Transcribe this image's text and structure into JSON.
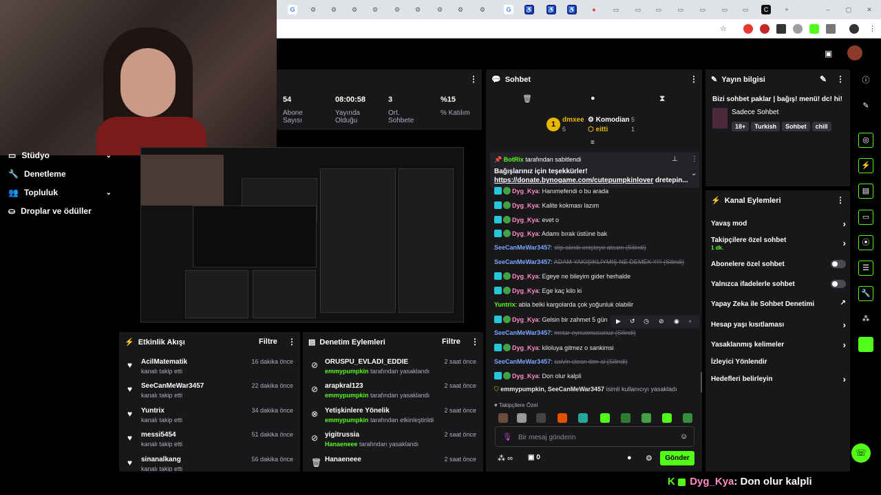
{
  "nav": {
    "items": [
      {
        "label": "Stüdyo",
        "icon": "studio-icon"
      },
      {
        "label": "Denetleme",
        "icon": "wrench-icon"
      },
      {
        "label": "Topluluk",
        "icon": "community-icon"
      },
      {
        "label": "Droplar ve ödüller",
        "icon": "gift-icon"
      }
    ]
  },
  "stats": [
    {
      "value": "54",
      "label1": "Abone",
      "label2": "Sayısı"
    },
    {
      "value": "08:00:58",
      "label1": "Yayında",
      "label2": "Olduğu"
    },
    {
      "value": "3",
      "label1": "Ort.",
      "label2": "Sohbete"
    },
    {
      "value": "%15",
      "label1": "% Katılım",
      "label2": ""
    }
  ],
  "activity": {
    "title": "Etkinlik Akışı",
    "filter": "Filtre",
    "items": [
      {
        "name": "AcilMatematik",
        "sub": "kanalı takip etti",
        "time": "16 dakika önce"
      },
      {
        "name": "SeeCanMeWar3457",
        "sub": "kanalı takip etti",
        "time": "22 dakika önce"
      },
      {
        "name": "Yuntrix",
        "sub": "kanalı takip etti",
        "time": "34 dakika önce"
      },
      {
        "name": "messi5454",
        "sub": "kanalı takip etti",
        "time": "51 dakika önce"
      },
      {
        "name": "sinanalkang",
        "sub": "kanalı takip etti",
        "time": "56 dakika önce"
      }
    ]
  },
  "moderation": {
    "title": "Denetim Eylemleri",
    "filter": "Filtre",
    "items": [
      {
        "name": "ORUSPU_EVLADI_EDDIE",
        "by": "emmypumpkin",
        "sub": "tarafından yasaklandı",
        "time": "2 saat önce"
      },
      {
        "name": "arapkral123",
        "by": "emmypumpkin",
        "sub": "tarafından yasaklandı",
        "time": "2 saat önce"
      },
      {
        "name": "Yetişkinlere Yönelik",
        "by": "emmypumpkin",
        "sub": "tarafından etkinleştirildi",
        "time": "2 saat önce"
      },
      {
        "name": "yigitrussia",
        "by": "Hanaeneee",
        "sub": "tarafından yasaklandı",
        "time": "2 saat önce"
      },
      {
        "name": "Hanaeneee",
        "by": "",
        "sub": "",
        "time": "2 saat önce"
      }
    ]
  },
  "chat": {
    "title": "Sohbet",
    "leaderboard": [
      {
        "name": "dmxee",
        "count": "5"
      },
      {
        "name": "Komodian",
        "count": "5"
      },
      {
        "name": "eitti",
        "count": "1"
      }
    ],
    "pinned": {
      "author": "BotRix",
      "label": "tarafından sabitlendi",
      "line1": "Bağışlarınız için teşekkürler!",
      "link": "https://donate.bynogame.com/cutepumpkinlover",
      "tail": "dretepin..."
    },
    "messages": [
      {
        "user": "Dyg_Kya",
        "text": "Hanımefendi o bu arada",
        "deleted": false,
        "color": "#ff8cc6"
      },
      {
        "user": "Dyg_Kya",
        "text": "Kalite kokması lazım",
        "deleted": false,
        "color": "#ff8cc6"
      },
      {
        "user": "Dyg_Kya",
        "text": "evet o",
        "deleted": false,
        "color": "#ff8cc6"
      },
      {
        "user": "Dyg_Kya",
        "text": "Adamı bırak üstüne bak",
        "deleted": false,
        "color": "#ff8cc6"
      },
      {
        "user": "SeeCanMeWar3457",
        "text": "clip alındı enişteye atcam (Silindi)",
        "deleted": true,
        "color": "#7aa7ff"
      },
      {
        "user": "SeeCanMeWar3457",
        "text": "ADAM YAKIŞIKLIYMIŞ NE DEMEK !!!!! (Silindi)",
        "deleted": true,
        "color": "#7aa7ff"
      },
      {
        "user": "Dyg_Kya",
        "text": "Egeye ne bileyim gider herhalde",
        "deleted": false,
        "color": "#ff8cc6"
      },
      {
        "user": "Dyg_Kya",
        "text": "Ege kaç kilo ki",
        "deleted": false,
        "color": "#ff8cc6"
      },
      {
        "user": "Yuntrix",
        "text": "abla belki kargolarda çok yoğunluk olabilir",
        "deleted": false,
        "color": "#53fc18"
      },
      {
        "user": "Dyg_Kya",
        "text": "Gelsin bir zahmet 5 gün",
        "deleted": false,
        "color": "#ff8cc6"
      },
      {
        "user": "SeeCanMeWar3457",
        "text": "mstar oynuomusunuz (Silindi)",
        "deleted": true,
        "color": "#7aa7ff"
      },
      {
        "user": "Dyg_Kya",
        "text": "kiloluya gitmez o sankimsi",
        "deleted": false,
        "color": "#ff8cc6"
      },
      {
        "user": "SeeCanMeWar3457",
        "text": "calvin clean don al (Silindi)",
        "deleted": true,
        "color": "#7aa7ff"
      },
      {
        "user": "Dyg_Kya",
        "text": "Don olur kalpli",
        "deleted": false,
        "color": "#ff8cc6"
      }
    ],
    "ban_notice": {
      "users": "emmypumpkin, SeeCanMeWar3457",
      "text": "isimli kullanıcıyı yasakladı"
    },
    "emote_section": "Takipçilere Özel",
    "input_placeholder": "Bir mesaj gönderin",
    "infinity_label": "∞",
    "gift_count": "0",
    "send_label": "Gönder"
  },
  "stream_info": {
    "title": "Yayın bilgisi",
    "stream_title": "Bizi sohbet paklar | bağış! menü! dc! hi!",
    "category": "Sadece Sohbet",
    "tags": [
      "18+",
      "Turkish",
      "Sohbet",
      "chill"
    ]
  },
  "channel_actions": {
    "title": "Kanal Eylemleri",
    "items": [
      {
        "label": "Yavaş mod",
        "kind": "arrow",
        "sub": ""
      },
      {
        "label": "Takipçilere özel sohbet",
        "kind": "arrow",
        "sub": "1 dk."
      },
      {
        "label": "Abonelere özel sohbet",
        "kind": "toggle",
        "sub": ""
      },
      {
        "label": "Yalnızca ifadelerle sohbet",
        "kind": "toggle",
        "sub": ""
      },
      {
        "label": "Yapay Zeka ile Sohbet Denetimi",
        "kind": "external",
        "sub": ""
      },
      {
        "label": "Hesap yaşı kısıtlaması",
        "kind": "arrow",
        "sub": ""
      },
      {
        "label": "Yasaklanmış kelimeler",
        "kind": "arrow",
        "sub": ""
      },
      {
        "label": "İzleyici Yönlendir",
        "kind": "none",
        "sub": ""
      },
      {
        "label": "Hedefleri belirleyin",
        "kind": "arrow",
        "sub": ""
      }
    ]
  },
  "overlay": {
    "user": "Dyg_Kya",
    "text": ": Don olur kalpli"
  },
  "colors": {
    "accent": "#53fc18",
    "panel": "#18181b",
    "bg": "#000000"
  }
}
